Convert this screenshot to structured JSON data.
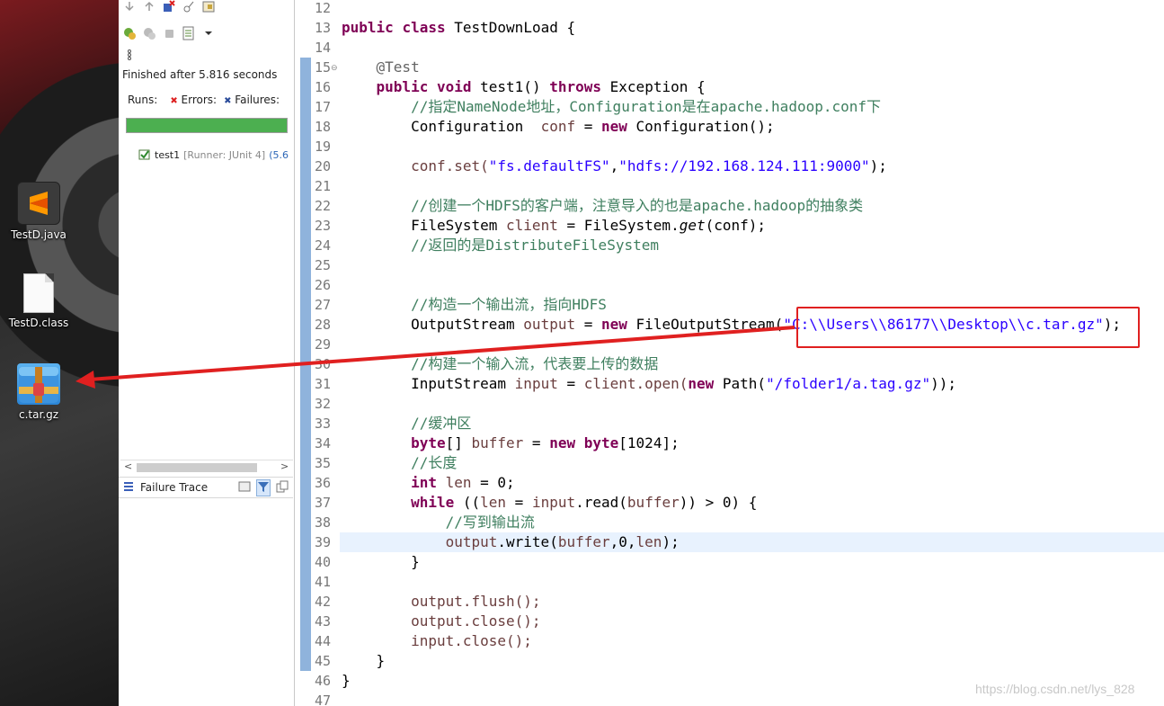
{
  "desktop": {
    "icons": [
      {
        "label": "TestD.java",
        "icon": "sublime-text-icon"
      },
      {
        "label": "TestD.class",
        "icon": "blank-file-icon"
      },
      {
        "label": "c.tar.gz",
        "icon": "winrar-archive-icon"
      }
    ]
  },
  "junit": {
    "finished": "Finished after 5.816 seconds",
    "runs_label": "Runs:",
    "errors_label": "Errors:",
    "failures_label": "Failures:",
    "progress_fraction": 1.0,
    "progress_color": "#4caf50",
    "test_item": {
      "name": "test1",
      "runner": "[Runner: JUnit 4]",
      "time": "(5.6"
    },
    "failure_trace_label": "Failure Trace"
  },
  "editor": {
    "line_numbers": [
      "12",
      "13",
      "14",
      "15",
      "16",
      "17",
      "18",
      "19",
      "20",
      "21",
      "22",
      "23",
      "24",
      "25",
      "26",
      "27",
      "28",
      "29",
      "30",
      "31",
      "32",
      "33",
      "34",
      "35",
      "36",
      "37",
      "38",
      "39",
      "40",
      "41",
      "42",
      "43",
      "44",
      "45",
      "46",
      "47"
    ],
    "class_decl": {
      "kw1": "public",
      "kw2": "class",
      "name": "TestDownLoad {"
    },
    "annotation": "@Test",
    "method": {
      "kw1": "public",
      "kw2": "void",
      "name": "test1()",
      "throws": "throws",
      "exc": "Exception {"
    },
    "comment_namenode": "//指定NameNode地址，Configuration是在apache.hadoop.conf下",
    "conf_type": "Configuration",
    "conf_var": "conf",
    "kw_new": "new",
    "conf_ctor": "Configuration();",
    "set_call": "conf.set(",
    "set_key": "\"fs.defaultFS\"",
    "set_val": "\"hdfs://192.168.124.111:9000\"",
    "comment_client": "//创建一个HDFS的客户端，注意导入的也是apache.hadoop的抽象类",
    "fs_type": "FileSystem",
    "client_var": "client",
    "fs_get": "FileSystem.",
    "get_method": "get",
    "get_arg": "(conf);",
    "comment_return": "//返回的是DistributeFileSystem",
    "comment_output": "//构造一个输出流，指向HDFS",
    "os_type": "OutputStream",
    "output_var": "output",
    "fos_ctor": "FileOutputStream(",
    "output_path": "\"C:\\\\Users\\\\86177\\\\Desktop\\\\c.tar.gz\"",
    "comment_input": "//构建一个输入流，代表要上传的数据",
    "is_type": "InputStream",
    "input_var": "input",
    "client_open": "client.open(",
    "path_ctor": "Path(",
    "input_path": "\"/folder1/a.tag.gz\"",
    "comment_buffer": "//缓冲区",
    "kw_byte": "byte",
    "buffer_var": "buffer",
    "buffer_size": "[1024];",
    "comment_len": "//长度",
    "kw_int": "int",
    "len_var": "len",
    "kw_while": "while",
    "comment_write": "//写到输出流",
    "flush_call": "output.flush();",
    "close_call": "output.close();",
    "input_close": "input.close();"
  },
  "watermark": "https://blog.csdn.net/lys_828",
  "colors": {
    "highlight_box": "#e02020",
    "arrow": "#e02020",
    "ruler": "#8fb3dc",
    "keyword": "#7f0055",
    "string": "#2a00ff",
    "comment": "#3f7f5f"
  }
}
